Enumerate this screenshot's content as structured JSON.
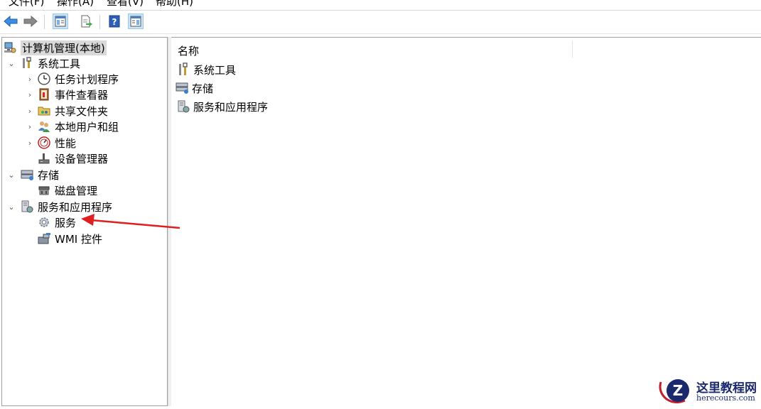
{
  "menu": {
    "file": "文件(F)",
    "action": "操作(A)",
    "view": "查看(V)",
    "help": "帮助(H)"
  },
  "toolbar": {
    "back_icon": "back-arrow-icon",
    "forward_icon": "forward-arrow-icon",
    "show_hide_tree_icon": "show-hide-console-tree-icon",
    "export_list_icon": "export-list-icon",
    "help_icon": "help-icon",
    "show_hide_action_icon": "show-hide-action-pane-icon"
  },
  "tree": {
    "root": "计算机管理(本地)",
    "system_tools": "系统工具",
    "task_scheduler": "任务计划程序",
    "event_viewer": "事件查看器",
    "shared_folders": "共享文件夹",
    "local_users": "本地用户和组",
    "performance": "性能",
    "device_manager": "设备管理器",
    "storage": "存储",
    "disk_management": "磁盘管理",
    "services_apps": "服务和应用程序",
    "services": "服务",
    "wmi": "WMI 控件"
  },
  "list": {
    "column_name": "名称",
    "items": [
      "系统工具",
      "存储",
      "服务和应用程序"
    ]
  },
  "watermark": {
    "title": "这里教程网",
    "url": "herecours.com"
  },
  "colors": {
    "annotation_arrow": "#e02020",
    "selection": "#d9d9d9",
    "toolbar_active": "#cce4f7"
  }
}
